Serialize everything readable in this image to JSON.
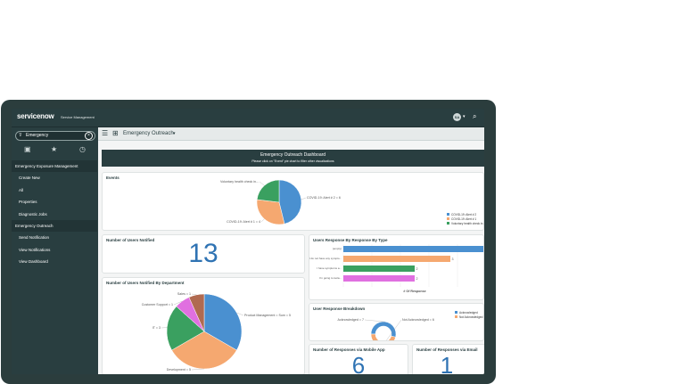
{
  "header": {
    "logo": "servicenow",
    "product": "Service Management",
    "user_initials": "SA"
  },
  "sidebar": {
    "filter_value": "Emergency",
    "items": [
      {
        "label": "Emergency Exposure Management",
        "kind": "header"
      },
      {
        "label": "Create New",
        "kind": "item"
      },
      {
        "label": "All",
        "kind": "item"
      },
      {
        "label": "Properties",
        "kind": "item"
      },
      {
        "label": "Diagnostic Jobs",
        "kind": "item"
      },
      {
        "label": "Emergency Outreach",
        "kind": "section"
      },
      {
        "label": "Send Notification",
        "kind": "item"
      },
      {
        "label": "View Notifications",
        "kind": "item"
      },
      {
        "label": "View Dashboard",
        "kind": "item"
      }
    ]
  },
  "tabbar": {
    "title": "Emergency Outreach"
  },
  "dashboard": {
    "title": "Emergency Outreach Dashboard",
    "subtitle": "Please click on \"Event\" pie chart to filter other visualizations"
  },
  "events_card": {
    "title": "Events"
  },
  "notified_card": {
    "title": "Number of Users Notified",
    "value": "13"
  },
  "department_card": {
    "title": "Number of Users Notified By Department"
  },
  "response_type_card": {
    "title": "Users Response By Response By Type"
  },
  "breakdown_card": {
    "title": "User Response Breakdown"
  },
  "mobile_card": {
    "title": "Number of Responses via Mobile App",
    "value": "6"
  },
  "email_card": {
    "title": "Number of Responses via Email",
    "value": "1"
  },
  "chart_data": [
    {
      "type": "pie",
      "name": "Events",
      "labels": [
        "COVID-19: Alert # 2",
        "COVID-19: Alert # 1",
        "Voluntary health check in..."
      ],
      "callouts": [
        "COVID-19: Alert # 2 = 6",
        "COVID-19: Alert # 1 = 4",
        "Voluntary health check in..."
      ],
      "values": [
        6,
        4,
        3
      ],
      "colors": [
        "#4a90d0",
        "#f5a870",
        "#3aa060"
      ]
    },
    {
      "type": "pie",
      "name": "Number of Users Notified By Department",
      "labels": [
        "Product Management",
        "Development",
        "IT",
        "Customer Support",
        "Sales"
      ],
      "callouts": [
        "Product Management = Sum = 5",
        "Development = 5",
        "IT = 3",
        "Customer Support = 1",
        "Sales = 1"
      ],
      "values": [
        5,
        5,
        3,
        1,
        1
      ],
      "colors": [
        "#4a90d0",
        "#f5a870",
        "#3aa060",
        "#e070e0",
        "#b06a50"
      ]
    },
    {
      "type": "bar",
      "orientation": "horizontal",
      "name": "Users Response By Response By Type",
      "categories": [
        "(empty)",
        "I do not have any sympto...",
        "I have symptoms a...",
        "I'm going to isola..."
      ],
      "values": [
        5,
        3,
        2,
        2
      ],
      "colors": [
        "#4a90d0",
        "#f5a870",
        "#3aa060",
        "#e070e0"
      ],
      "xlabel": "# Of Response"
    },
    {
      "type": "pie",
      "name": "User Response Breakdown",
      "labels": [
        "Acknowledged",
        "Not Acknowledged"
      ],
      "callouts": [
        "Acknowledged = 7",
        "Not Acknowledged = 6"
      ],
      "values": [
        7,
        6
      ],
      "colors": [
        "#4a90d0",
        "#f5a870"
      ]
    }
  ]
}
